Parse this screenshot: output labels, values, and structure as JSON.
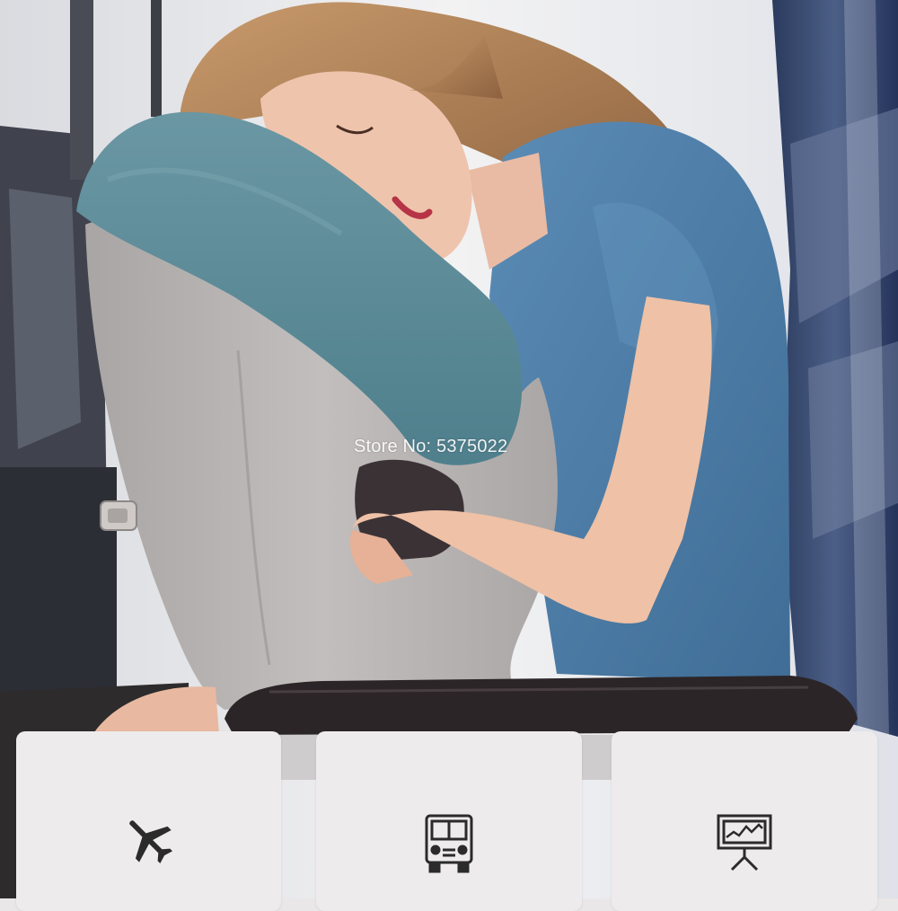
{
  "watermark": {
    "text": "Store No: 5375022"
  },
  "icons": [
    {
      "name": "airplane-icon",
      "color": "#2b2b2b"
    },
    {
      "name": "car-icon",
      "color": "#2b2b2b"
    },
    {
      "name": "presentation-board-icon",
      "color": "#2b2b2b"
    }
  ],
  "palette": {
    "shirt": "#4f7fa8",
    "pillow_cover": "#5c8a96",
    "pillow_body": "#b7b3b2",
    "seat": "#2f4267",
    "card_bg": "#eeebec",
    "armrest": "#2a2424"
  }
}
